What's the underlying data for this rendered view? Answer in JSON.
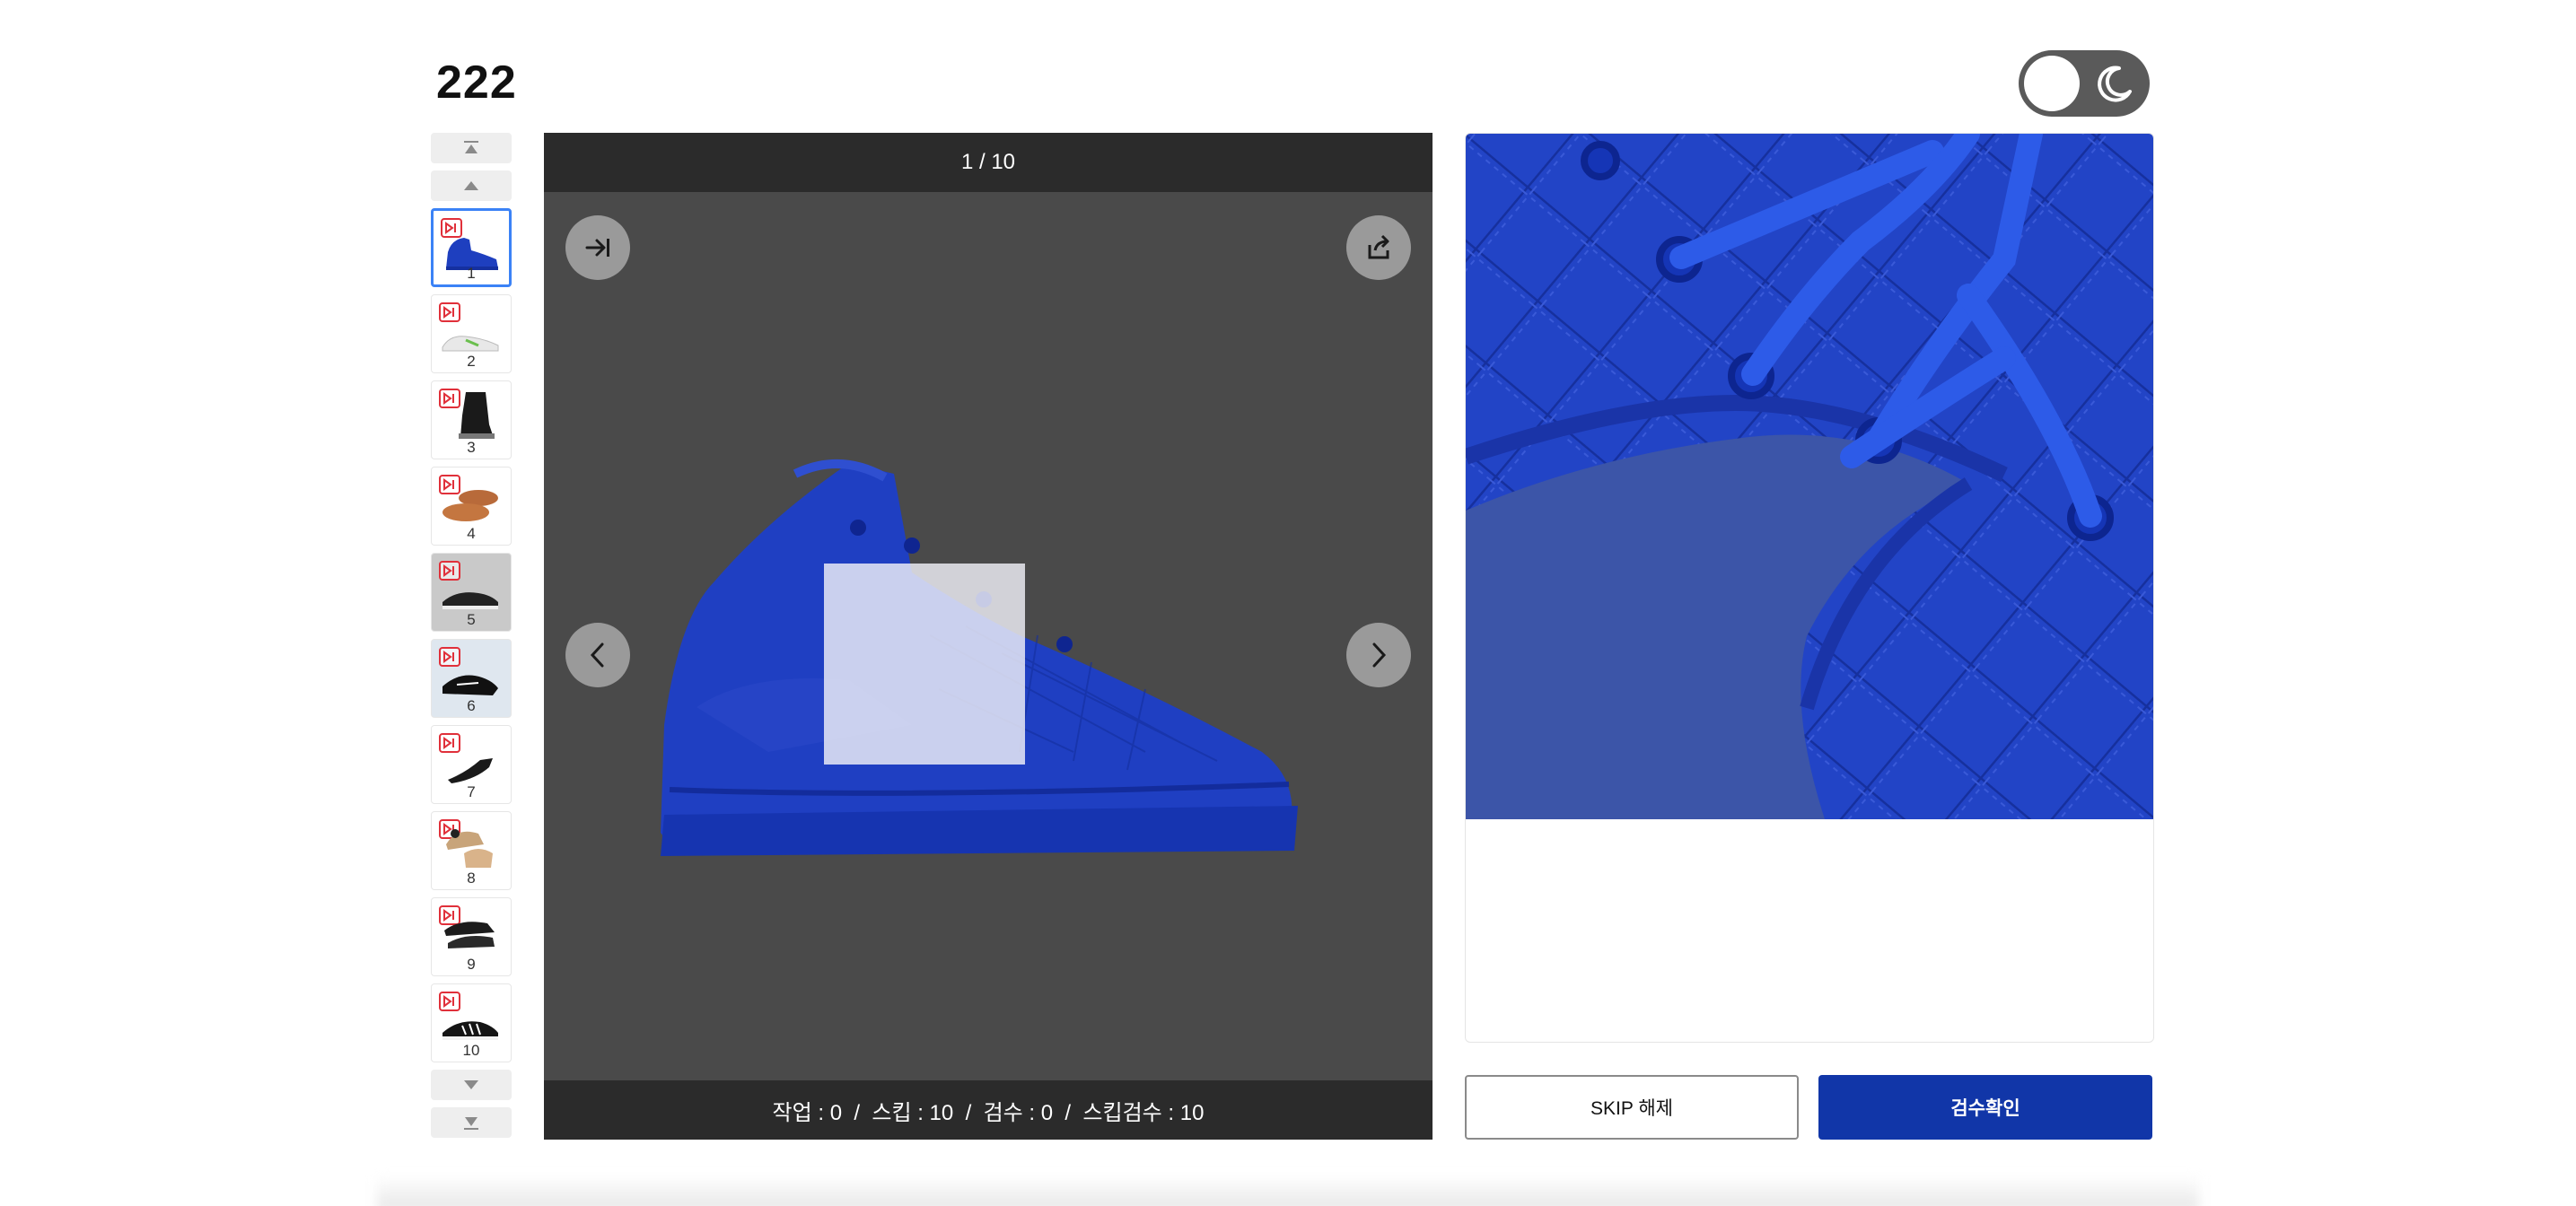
{
  "page": {
    "title": "222"
  },
  "theme_toggle": {
    "icon": "moon-icon",
    "state": "light"
  },
  "thumbnails": {
    "scroll_top_icon": "double-up-arrow-icon",
    "scroll_up_icon": "up-arrow-icon",
    "scroll_down_icon": "down-arrow-icon",
    "scroll_bottom_icon": "double-down-arrow-icon",
    "items": [
      {
        "label": "1",
        "active": true,
        "badge_icon": "skip-icon"
      },
      {
        "label": "2",
        "active": false,
        "badge_icon": "skip-icon"
      },
      {
        "label": "3",
        "active": false,
        "badge_icon": "skip-icon"
      },
      {
        "label": "4",
        "active": false,
        "badge_icon": "skip-icon"
      },
      {
        "label": "5",
        "active": false,
        "badge_icon": "skip-icon"
      },
      {
        "label": "6",
        "active": false,
        "badge_icon": "skip-icon"
      },
      {
        "label": "7",
        "active": false,
        "badge_icon": "skip-icon"
      },
      {
        "label": "8",
        "active": false,
        "badge_icon": "skip-icon"
      },
      {
        "label": "9",
        "active": false,
        "badge_icon": "skip-icon"
      },
      {
        "label": "10",
        "active": false,
        "badge_icon": "skip-icon"
      }
    ]
  },
  "viewer": {
    "counter": "1 / 10",
    "stats": "작업 : 0  /  스킵 : 10  /  검수 : 0  /  스킵검수 : 10",
    "skip_to_end_icon": "arrow-to-end-icon",
    "share_icon": "share-icon",
    "prev_icon": "chevron-left-icon",
    "next_icon": "chevron-right-icon"
  },
  "actions": {
    "skip_release_label": "SKIP 해제",
    "confirm_label": "검수확인",
    "accent_color": "#1136a8"
  }
}
